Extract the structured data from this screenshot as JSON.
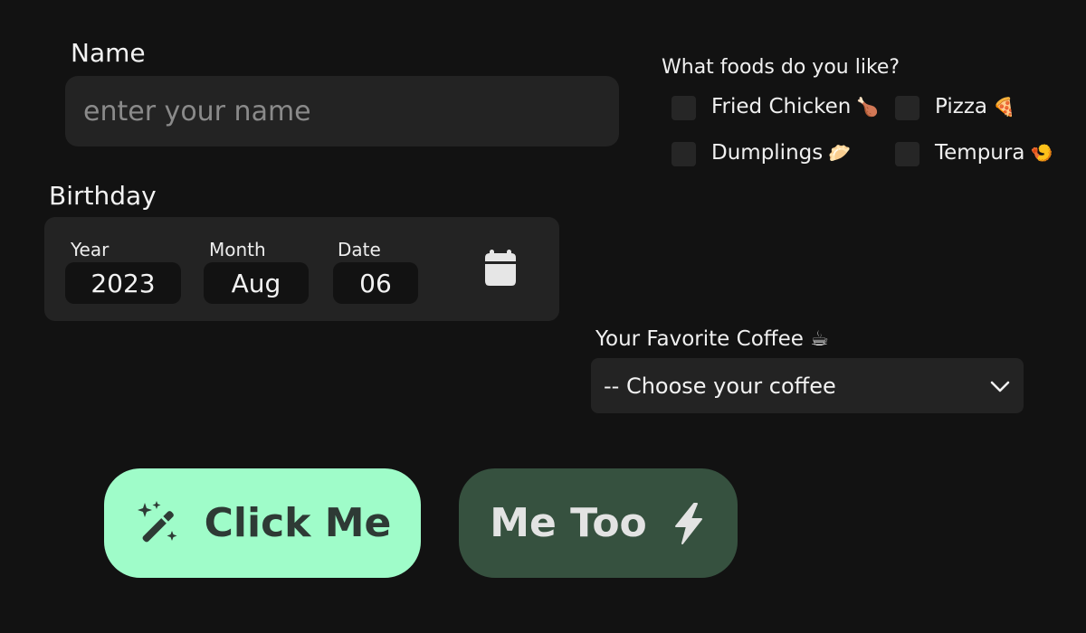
{
  "name_section": {
    "label": "Name",
    "placeholder": "enter your name",
    "value": ""
  },
  "birthday_section": {
    "label": "Birthday",
    "year_label": "Year",
    "year_value": "2023",
    "month_label": "Month",
    "month_value": "Aug",
    "date_label": "Date",
    "date_value": "06",
    "calendar_icon": "calendar-icon"
  },
  "foods_section": {
    "question": "What foods do you like?",
    "options": [
      {
        "label": "Fried Chicken",
        "emoji": "🍗",
        "checked": false
      },
      {
        "label": "Pizza",
        "emoji": "🍕",
        "checked": false
      },
      {
        "label": "Dumplings",
        "emoji": "🥟",
        "checked": false
      },
      {
        "label": "Tempura",
        "emoji": "🍤",
        "checked": false
      }
    ]
  },
  "coffee_section": {
    "label": "Your Favorite Coffee ☕",
    "selected": "-- Choose your coffee",
    "dropdown_icon": "chevron-down-icon"
  },
  "buttons": {
    "click_me": {
      "label": "Click Me",
      "icon": "magic-wand-sparkles-icon"
    },
    "me_too": {
      "label": "Me Too",
      "icon": "lightning-bolt-icon"
    }
  },
  "colors": {
    "background": "#121212",
    "panel": "#232323",
    "click_me_bg": "#9ffcc9",
    "me_too_bg": "#36513f"
  }
}
